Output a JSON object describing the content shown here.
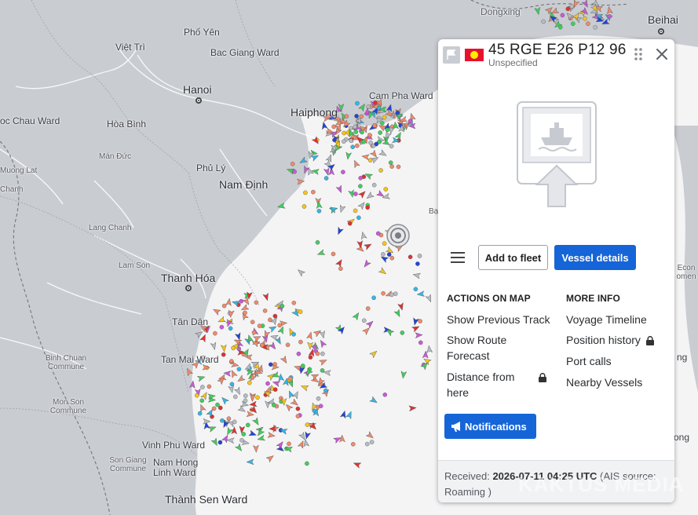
{
  "map": {
    "places": [
      {
        "name": "Việt Trì",
        "size": "normal"
      },
      {
        "name": "Phố Yên",
        "size": "normal"
      },
      {
        "name": "Bac Giang Ward",
        "size": "normal"
      },
      {
        "name": "Hanoi",
        "size": "big"
      },
      {
        "name": "Haiphong",
        "size": "big"
      },
      {
        "name": "Cam Pha Ward",
        "size": "normal"
      },
      {
        "name": "Dongxing",
        "size": "normal"
      },
      {
        "name": "Beihai",
        "size": "big"
      },
      {
        "name": "Hòa Bình",
        "size": "normal"
      },
      {
        "name": "oc Chau Ward",
        "size": "normal"
      },
      {
        "name": "Mán Đức",
        "size": "small"
      },
      {
        "name": "Muong Lat",
        "size": "small"
      },
      {
        "name": "Chanh",
        "size": "small"
      },
      {
        "name": "Phủ Lý",
        "size": "normal"
      },
      {
        "name": "Nam Định",
        "size": "big"
      },
      {
        "name": "Lang Chanh",
        "size": "small"
      },
      {
        "name": "Lam Son",
        "size": "small"
      },
      {
        "name": "Thanh Hóa",
        "size": "big"
      },
      {
        "name": "Tân Dân",
        "size": "normal"
      },
      {
        "name": "Tan Mai Ward",
        "size": "normal"
      },
      {
        "name": "Binh Chuan Commune",
        "size": "small"
      },
      {
        "name": "Mon Son Commune",
        "size": "small"
      },
      {
        "name": "Vinh Phu Ward",
        "size": "normal"
      },
      {
        "name": "Son Giang Commune",
        "size": "small"
      },
      {
        "name": "Nam Hong Linh Ward",
        "size": "normal"
      },
      {
        "name": "Thành Sen Ward",
        "size": "big"
      },
      {
        "name": "Bạ",
        "size": "small"
      },
      {
        "name": "Econ omen",
        "size": "small"
      },
      {
        "name": "ng",
        "size": "normal"
      },
      {
        "name": "ong",
        "size": "normal"
      }
    ]
  },
  "panel": {
    "vessel_name": "45 RGE E26 P12 96",
    "vessel_type": "Unspecified",
    "add_to_fleet_label": "Add to fleet",
    "vessel_details_label": "Vessel details",
    "actions_title": "ACTIONS ON MAP",
    "actions": [
      "Show Previous Track",
      "Show Route Forecast",
      "Distance from here"
    ],
    "more_info_title": "MORE INFO",
    "more_info": [
      "Voyage Timeline",
      "Position history",
      "Port calls",
      "Nearby Vessels"
    ],
    "notifications_label": "Notifications",
    "received_prefix": "Received:",
    "received_time": "2026-07-11 04:25 UTC",
    "received_source": "(AIS source: Roaming )",
    "colors": {
      "accent": "#1565d8",
      "flag_red": "#e8112d",
      "flag_yellow": "#ffef00"
    }
  },
  "watermark": "KAKTUS MEDIA"
}
